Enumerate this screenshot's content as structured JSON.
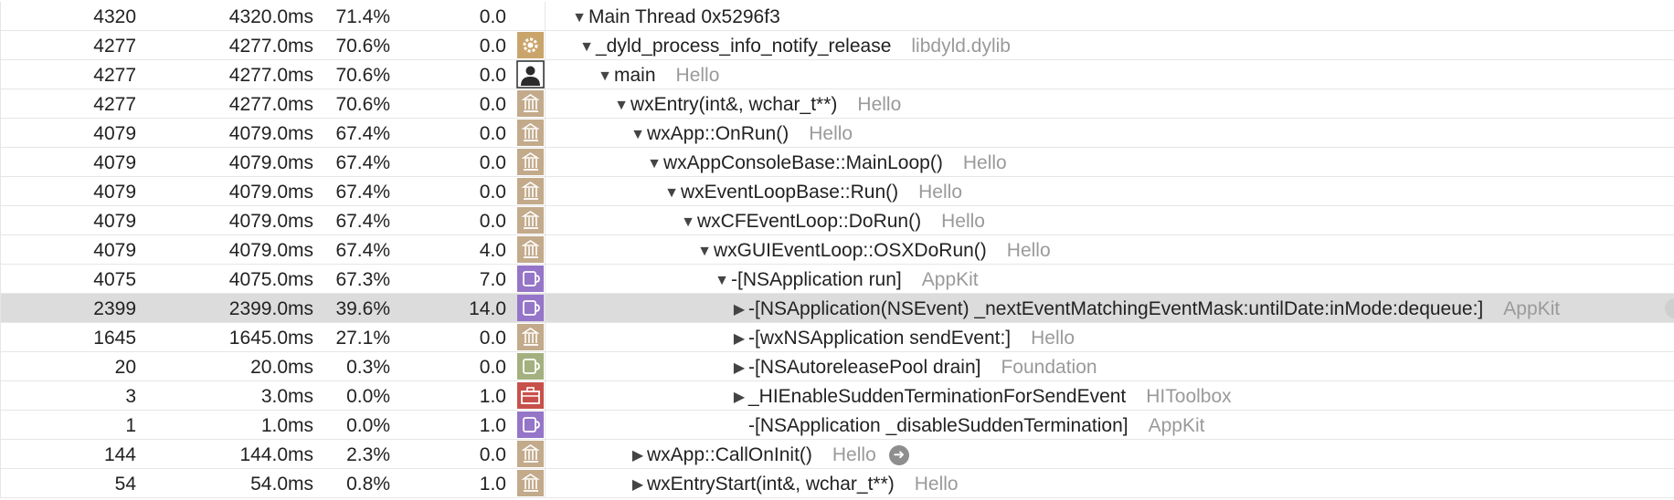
{
  "colors": {
    "selected_row": "#dcdcdc",
    "library_text": "#9a9a9a",
    "icon_framework": "#c2aa8b",
    "icon_appkit": "#9575c8",
    "icon_foundation": "#a4b07f",
    "icon_toolbox": "#c8504b",
    "icon_system": "#caa56b",
    "icon_user": "#2b2b2b"
  },
  "rows": [
    {
      "samples": "4320",
      "time": "4320.0ms",
      "pct": "71.4%",
      "self": "0.0",
      "icon": "none",
      "toggle": "expanded",
      "symbol": "Main Thread  0x5296f3",
      "library": ""
    },
    {
      "samples": "4277",
      "time": "4277.0ms",
      "pct": "70.6%",
      "self": "0.0",
      "icon": "gear-icon",
      "toggle": "expanded",
      "symbol": "_dyld_process_info_notify_release",
      "library": "libdyld.dylib"
    },
    {
      "samples": "4277",
      "time": "4277.0ms",
      "pct": "70.6%",
      "self": "0.0",
      "icon": "user-icon",
      "toggle": "expanded",
      "symbol": "main",
      "library": "Hello"
    },
    {
      "samples": "4277",
      "time": "4277.0ms",
      "pct": "70.6%",
      "self": "0.0",
      "icon": "framework-icon",
      "toggle": "expanded",
      "symbol": "wxEntry(int&, wchar_t**)",
      "library": "Hello"
    },
    {
      "samples": "4079",
      "time": "4079.0ms",
      "pct": "67.4%",
      "self": "0.0",
      "icon": "framework-icon",
      "toggle": "expanded",
      "symbol": "wxApp::OnRun()",
      "library": "Hello"
    },
    {
      "samples": "4079",
      "time": "4079.0ms",
      "pct": "67.4%",
      "self": "0.0",
      "icon": "framework-icon",
      "toggle": "expanded",
      "symbol": "wxAppConsoleBase::MainLoop()",
      "library": "Hello"
    },
    {
      "samples": "4079",
      "time": "4079.0ms",
      "pct": "67.4%",
      "self": "0.0",
      "icon": "framework-icon",
      "toggle": "expanded",
      "symbol": "wxEventLoopBase::Run()",
      "library": "Hello"
    },
    {
      "samples": "4079",
      "time": "4079.0ms",
      "pct": "67.4%",
      "self": "0.0",
      "icon": "framework-icon",
      "toggle": "expanded",
      "symbol": "wxCFEventLoop::DoRun()",
      "library": "Hello"
    },
    {
      "samples": "4079",
      "time": "4079.0ms",
      "pct": "67.4%",
      "self": "4.0",
      "icon": "framework-icon",
      "toggle": "expanded",
      "symbol": "wxGUIEventLoop::OSXDoRun()",
      "library": "Hello"
    },
    {
      "samples": "4075",
      "time": "4075.0ms",
      "pct": "67.3%",
      "self": "7.0",
      "icon": "appkit-icon",
      "toggle": "expanded",
      "symbol": "-[NSApplication run]",
      "library": "AppKit"
    },
    {
      "samples": "2399",
      "time": "2399.0ms",
      "pct": "39.6%",
      "self": "14.0",
      "icon": "appkit-icon",
      "toggle": "collapsed",
      "symbol": "-[NSApplication(NSEvent) _nextEventMatchingEventMask:untilDate:inMode:dequeue:]",
      "library": "AppKit",
      "selected": true
    },
    {
      "samples": "1645",
      "time": "1645.0ms",
      "pct": "27.1%",
      "self": "0.0",
      "icon": "framework-icon",
      "toggle": "collapsed",
      "symbol": "-[wxNSApplication sendEvent:]",
      "library": "Hello"
    },
    {
      "samples": "20",
      "time": "20.0ms",
      "pct": "0.3%",
      "self": "0.0",
      "icon": "foundation-icon",
      "toggle": "collapsed",
      "symbol": "-[NSAutoreleasePool drain]",
      "library": "Foundation"
    },
    {
      "samples": "3",
      "time": "3.0ms",
      "pct": "0.0%",
      "self": "1.0",
      "icon": "toolbox-icon",
      "toggle": "collapsed",
      "symbol": "_HIEnableSuddenTerminationForSendEvent",
      "library": "HIToolbox"
    },
    {
      "samples": "1",
      "time": "1.0ms",
      "pct": "0.0%",
      "self": "1.0",
      "icon": "appkit-icon",
      "toggle": "none",
      "symbol": "-[NSApplication _disableSuddenTermination]",
      "library": "AppKit"
    },
    {
      "samples": "144",
      "time": "144.0ms",
      "pct": "2.3%",
      "self": "0.0",
      "icon": "framework-icon",
      "toggle": "collapsed",
      "symbol": "wxApp::CallOnInit()",
      "library": "Hello",
      "go_button": true
    },
    {
      "samples": "54",
      "time": "54.0ms",
      "pct": "0.8%",
      "self": "1.0",
      "icon": "framework-icon",
      "toggle": "collapsed",
      "symbol": "wxEntryStart(int&, wchar_t**)",
      "library": "Hello"
    }
  ]
}
